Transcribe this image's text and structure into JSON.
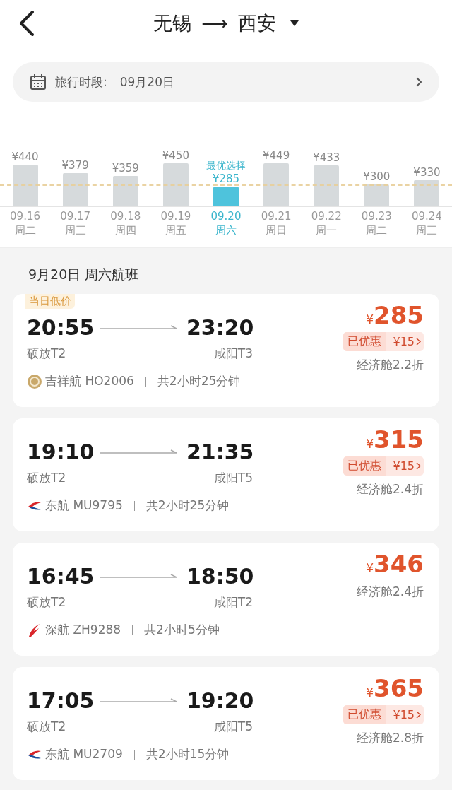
{
  "header": {
    "origin": "无锡",
    "destination": "西安",
    "arrow": "⟶"
  },
  "date_bar": {
    "label": "旅行时段:",
    "value": "09月20日"
  },
  "price_calendar": [
    {
      "price": "¥440",
      "date": "09.16",
      "weekday": "周二",
      "selected": false
    },
    {
      "price": "¥379",
      "date": "09.17",
      "weekday": "周三",
      "selected": false
    },
    {
      "price": "¥359",
      "date": "09.18",
      "weekday": "周四",
      "selected": false
    },
    {
      "price": "¥450",
      "date": "09.19",
      "weekday": "周五",
      "selected": false
    },
    {
      "price": "¥285",
      "date": "09.20",
      "weekday": "周六",
      "selected": true,
      "badge": "最优选择"
    },
    {
      "price": "¥449",
      "date": "09.21",
      "weekday": "周日",
      "selected": false
    },
    {
      "price": "¥433",
      "date": "09.22",
      "weekday": "周一",
      "selected": false
    },
    {
      "price": "¥300",
      "date": "09.23",
      "weekday": "周二",
      "selected": false
    },
    {
      "price": "¥330",
      "date": "09.24",
      "weekday": "周三",
      "selected": false
    }
  ],
  "section_title": "9月20日 周六航班",
  "flights": [
    {
      "tag": "当日低价",
      "depart_time": "20:55",
      "arrive_time": "23:20",
      "depart_airport": "硕放T2",
      "arrive_airport": "咸阳T3",
      "kind": "jixiang",
      "airline": "吉祥航 HO2006",
      "duration": "共2小时25分钟",
      "currency": "¥",
      "price": "285",
      "discount": {
        "label": "已优惠",
        "amount": "¥15"
      },
      "cabin": "经济舱2.2折"
    },
    {
      "depart_time": "19:10",
      "arrive_time": "21:35",
      "depart_airport": "硕放T2",
      "arrive_airport": "咸阳T5",
      "kind": "eastern",
      "airline": "东航 MU9795",
      "duration": "共2小时25分钟",
      "currency": "¥",
      "price": "315",
      "discount": {
        "label": "已优惠",
        "amount": "¥15"
      },
      "cabin": "经济舱2.4折"
    },
    {
      "depart_time": "16:45",
      "arrive_time": "18:50",
      "depart_airport": "硕放T2",
      "arrive_airport": "咸阳T2",
      "kind": "shenzhen",
      "airline": "深航 ZH9288",
      "duration": "共2小时5分钟",
      "currency": "¥",
      "price": "346",
      "cabin": "经济舱2.4折"
    },
    {
      "depart_time": "17:05",
      "arrive_time": "19:20",
      "depart_airport": "硕放T2",
      "arrive_airport": "咸阳T5",
      "kind": "eastern",
      "airline": "东航 MU2709",
      "duration": "共2小时15分钟",
      "currency": "¥",
      "price": "365",
      "discount": {
        "label": "已优惠",
        "amount": "¥15"
      },
      "cabin": "经济舱2.8折"
    }
  ]
}
